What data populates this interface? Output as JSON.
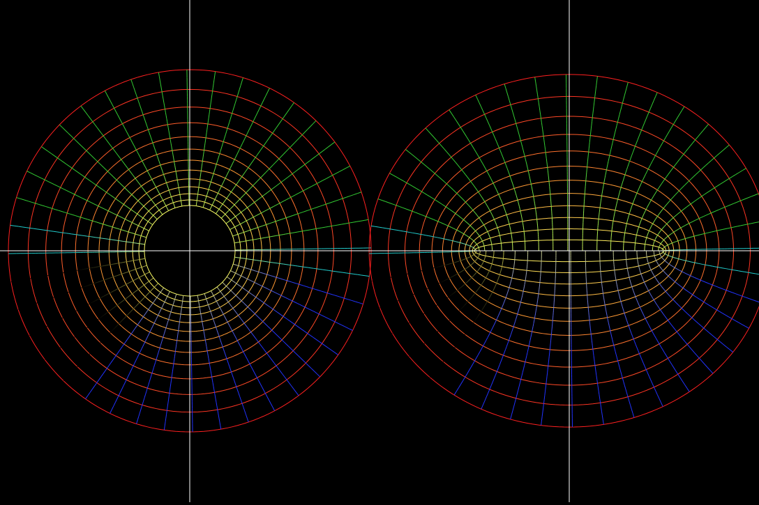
{
  "figure": {
    "background": "#000000",
    "axis_color": "#ffffff"
  },
  "mapping": {
    "type": "joukowski",
    "circle_plot": {
      "inner_radius": 1.0,
      "outer_radius": 4.0,
      "ring_count": 13,
      "ray_count": 40
    },
    "airfoil_plot": {
      "transform": "z + 1/z"
    }
  },
  "colors": {
    "ring_inner": "#ffff66",
    "ring_mid": "#ff9933",
    "ring_outer": "#ff2020",
    "ray_upper_inner": "#ccff66",
    "ray_upper_outer": "#33cc33",
    "ray_side": "#22cccc",
    "ray_lower": "#2233ff"
  }
}
